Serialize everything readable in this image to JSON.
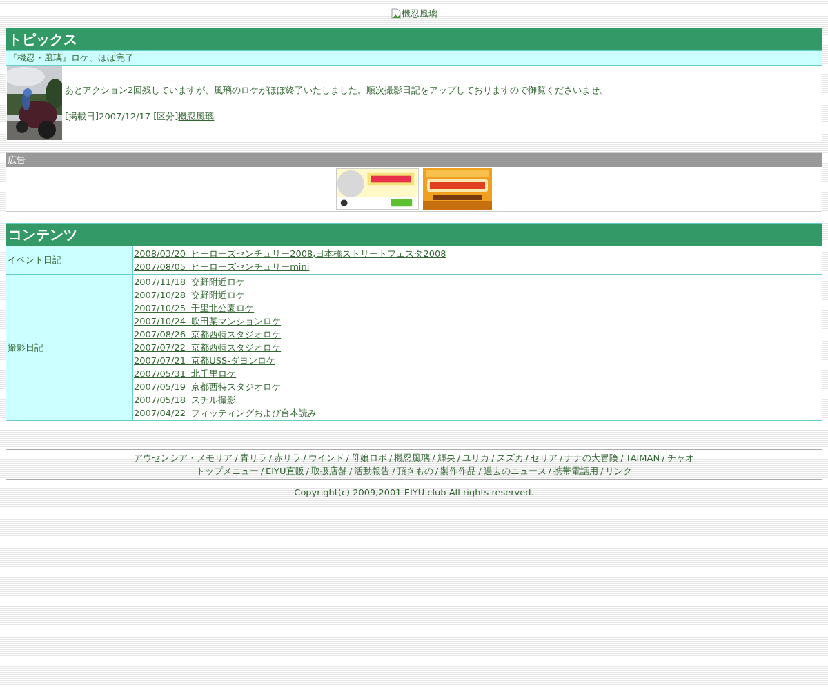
{
  "header_image": {
    "alt": "機忍風璃"
  },
  "topics": {
    "title": "トピックス",
    "headline": "『機忍・風璃』ロケ、ほぼ完了",
    "body": "あとアクション2回残していますが、風璃のロケがほぼ終了いたしました。順次撮影日記をアップしておりますので御覧くださいませ。",
    "meta": "[掲載日]2007/12/17 [区分]",
    "category_link": "機忍風璃"
  },
  "ads": {
    "title": "広告"
  },
  "contents": {
    "title": "コンテンツ",
    "sections": [
      {
        "label": "イベント日記",
        "links": [
          "2008/03/20  ヒーローズセンチュリー2008,日本橋ストリートフェスタ2008",
          "2007/08/05  ヒーローズセンチュリーmini"
        ]
      },
      {
        "label": "撮影日記",
        "links": [
          "2007/11/18  交野附近ロケ",
          "2007/10/28  交野附近ロケ",
          "2007/10/25  千里北公園ロケ",
          "2007/10/24  吹田某マンションロケ",
          "2007/08/26  京都西特スタジオロケ",
          "2007/07/22  京都西特スタジオロケ",
          "2007/07/21  京都USS-ダヨンロケ",
          "2007/05/31  北千里ロケ",
          "2007/05/19  京都西特スタジオロケ",
          "2007/05/18  スチル撮影",
          "2007/04/22  フィッティングおよび台本読み"
        ]
      }
    ]
  },
  "footer": {
    "link_rows": [
      [
        "アウセンシア・メモリア",
        "青リラ",
        "赤リラ",
        "ウインド",
        "母娘ロボ",
        "機忍風璃",
        "輝央",
        "ユリカ",
        "スズカ",
        "セリア",
        "ナナの大冒険",
        "TAIMAN",
        "チャオ"
      ],
      [
        "トップメニュー",
        "EIYU直販",
        "取扱店舗",
        "活動報告",
        "頂きもの",
        "製作作品",
        "過去のニュース",
        "携帯電話用",
        "リンク"
      ]
    ],
    "separator": "/",
    "copyright": "Copyright(c) 2009,2001 EIYU club All rights reserved."
  }
}
